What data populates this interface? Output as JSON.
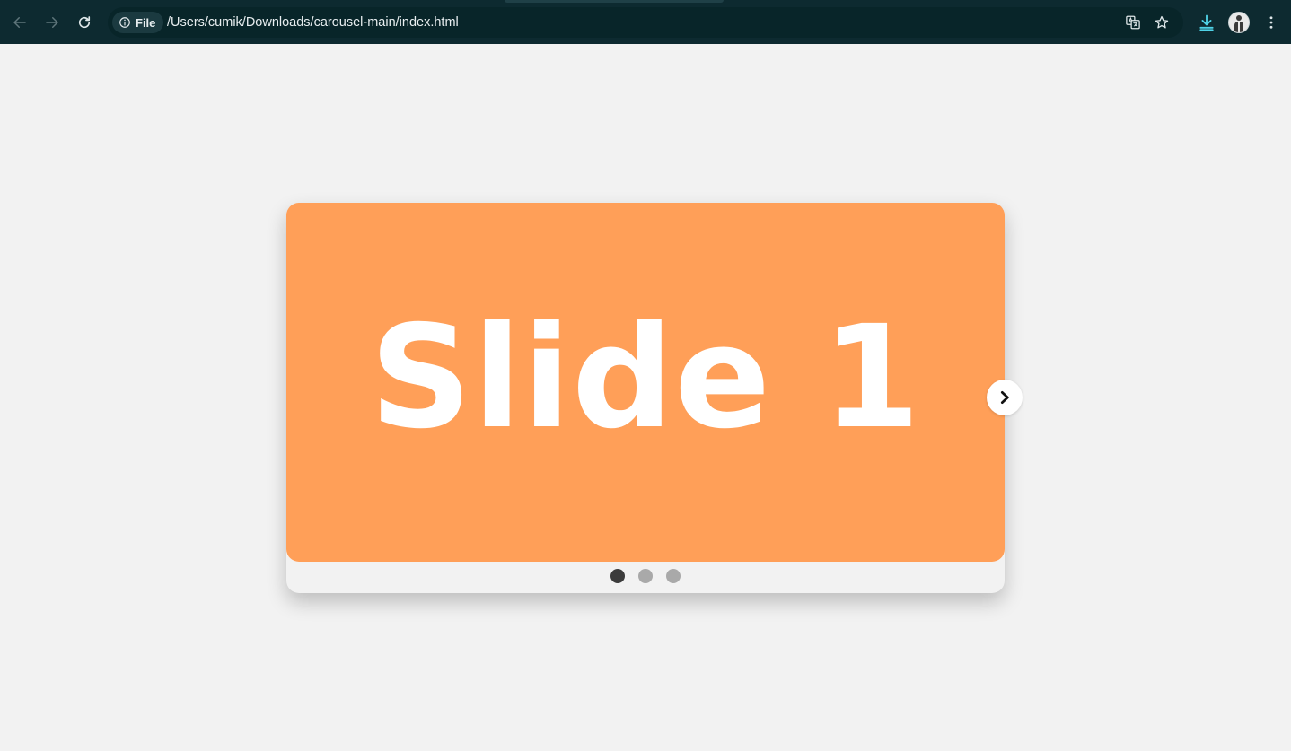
{
  "browser": {
    "address_chip_label": "File",
    "url": "/Users/cumik/Downloads/carousel-main/index.html",
    "icons": {
      "back": "arrow-left-icon",
      "forward": "arrow-right-icon",
      "reload": "reload-icon",
      "info": "info-icon",
      "translate": "translate-icon",
      "bookmark": "star-icon",
      "download": "download-icon",
      "profile": "avatar",
      "menu": "more-vert-icon"
    },
    "colors": {
      "chrome_bg": "#0d2a30",
      "download_accent": "#4fd2e6"
    }
  },
  "carousel": {
    "slides": [
      {
        "label": "Slide 1",
        "color": "#ff9f58"
      }
    ],
    "active_slide": 1,
    "total_slides": 3,
    "next_icon": "chevron-right-icon",
    "colors": {
      "dot_active": "#3c3c3c",
      "dot_inactive": "#a9a9a9"
    }
  }
}
